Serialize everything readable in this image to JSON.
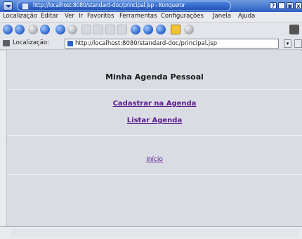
{
  "window": {
    "title": "http://localhost:8080/standard-doc/principal.jsp - Konqueror",
    "controls": [
      "?",
      "_",
      "▣",
      "x"
    ]
  },
  "menu": {
    "items": [
      "Localização",
      "Editar",
      "Ver",
      "Ir",
      "Favoritos",
      "Ferramentas",
      "Configurações",
      "Janela",
      "Ajuda"
    ]
  },
  "toolbar": {
    "icons": [
      "back-icon",
      "forward-icon",
      "up-icon",
      "home-icon",
      "reload-icon",
      "stop-icon",
      "cut-icon",
      "copy-icon",
      "paste-icon",
      "print-icon",
      "find-icon",
      "zoom-in-icon",
      "zoom-out-icon",
      "security-lock-icon",
      "settings-icon"
    ]
  },
  "location": {
    "label": "Localização:",
    "url": "http://localhost:8080/standard-doc/principal.jsp"
  },
  "page": {
    "title": "Minha Agenda Pessoal",
    "links": {
      "cadastrar": "Cadastrar na Agenda",
      "listar": "Listar Agenda",
      "inicio": "Início"
    }
  },
  "colors": {
    "titlebar": "#2b5fc4",
    "link": "#5a1a8a",
    "background": "#d9dce3"
  }
}
